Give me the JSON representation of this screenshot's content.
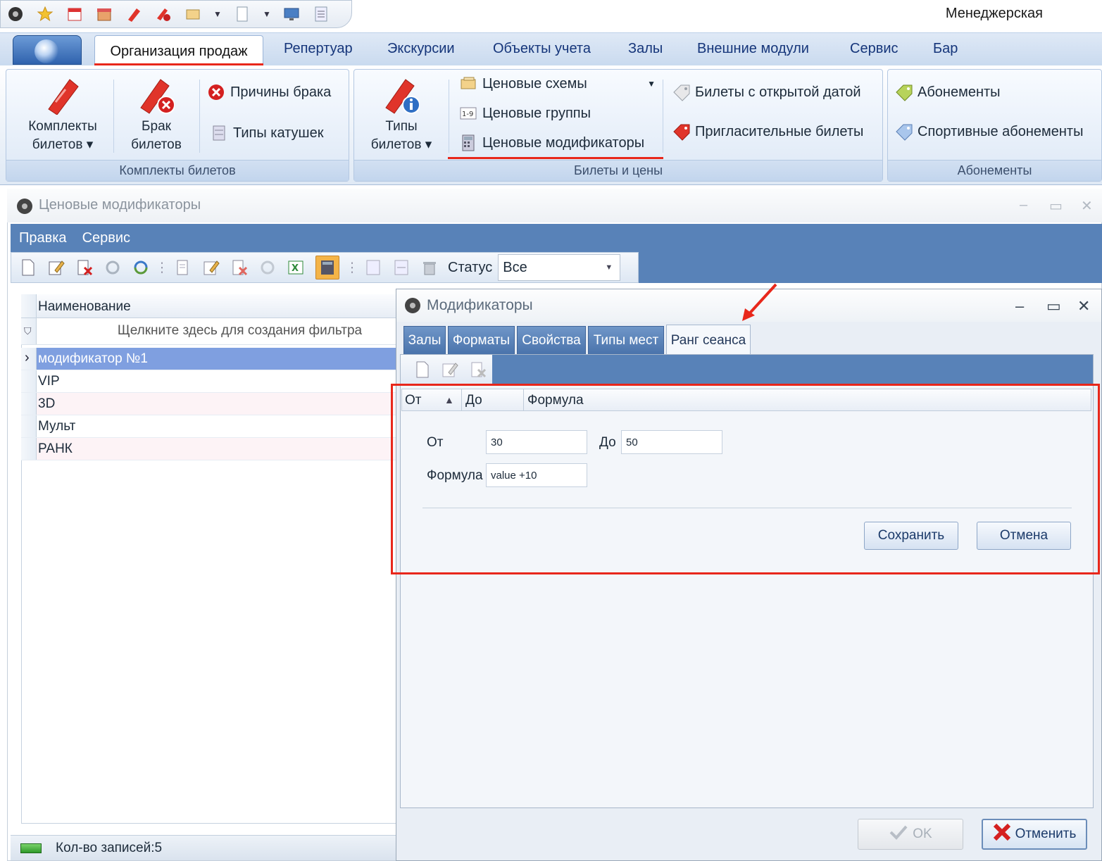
{
  "app": {
    "title": "Менеджерская"
  },
  "ribbon": {
    "tabs": [
      "Организация продаж",
      "Репертуар",
      "Экскурсии",
      "Объекты учета",
      "Залы",
      "Внешние модули",
      "Сервис",
      "Бар"
    ],
    "active_tab": "Организация продаж",
    "groups": {
      "komplekty": {
        "label": "Комплекты билетов",
        "komplekty_btn": {
          "line1": "Комплекты",
          "line2": "билетов ▾"
        },
        "brak_btn": {
          "line1": "Брак",
          "line2": "билетов"
        },
        "prichiny": "Причины брака",
        "tipy_katushek": "Типы катушек"
      },
      "bilety": {
        "label": "Билеты и цены",
        "tipy_btn": {
          "line1": "Типы",
          "line2": "билетов ▾"
        },
        "cenovye_shemy": "Ценовые схемы",
        "cenovye_gruppy": "Ценовые группы",
        "cenovye_modifikatory": "Ценовые модификаторы",
        "otkrytaya_data": "Билеты с открытой датой",
        "priglasitelnye": "Пригласительные билеты"
      },
      "abonementy": {
        "label": "Абонементы",
        "abonementy": "Абонементы",
        "sportivnye": "Спортивные абонементы"
      }
    }
  },
  "modifiers_window": {
    "title": "Ценовые модификаторы",
    "menu": [
      "Правка",
      "Сервис"
    ],
    "status_label": "Статус",
    "status_value": "Все",
    "grid": {
      "column": "Наименование",
      "filter_hint": "Щелкните здесь для создания фильтра",
      "rows": [
        "модификатор №1",
        "VIP",
        "3D",
        "Мульт",
        "РАНК"
      ]
    },
    "record_count": "Кол-во записей:5"
  },
  "dialog": {
    "title": "Модификаторы",
    "tabs": [
      "Залы",
      "Форматы",
      "Свойства",
      "Типы мест",
      "Ранг сеанса"
    ],
    "active_tab": "Ранг сеанса",
    "columns": [
      "От",
      "До",
      "Формула"
    ],
    "form": {
      "from_label": "От",
      "from_value": "30",
      "to_label": "До",
      "to_value": "50",
      "formula_label": "Формула",
      "formula_value": "value +10",
      "save": "Сохранить",
      "cancel": "Отмена"
    },
    "ok": "OK",
    "cancel": "Отменить"
  },
  "colors": {
    "accent_blue": "#5882b8",
    "highlight_red": "#e8271b",
    "selected_row": "#7f9fe0"
  }
}
